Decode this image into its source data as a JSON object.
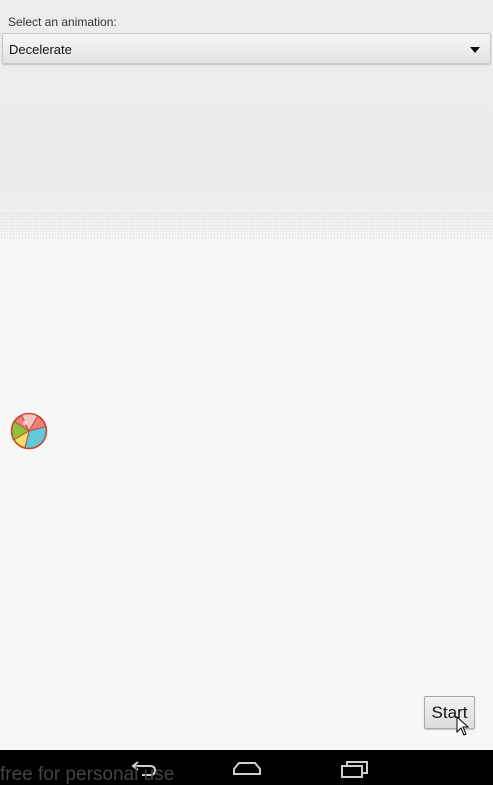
{
  "form": {
    "select_label": "Select an animation:",
    "selected_animation": "Decelerate"
  },
  "actions": {
    "start_label": "Start"
  },
  "navigation": {
    "icons": [
      "back-icon",
      "home-icon",
      "recent-apps-icon"
    ]
  },
  "watermark": {
    "text": "free for personal use"
  },
  "colors": {
    "background": "#f7f7f7",
    "navbar": "#000000",
    "ball_red": "#ef7f7f",
    "ball_blue": "#5fc9dd",
    "ball_yellow": "#ece06a",
    "ball_green": "#8fc13f",
    "ball_outline": "#c44a2d"
  }
}
